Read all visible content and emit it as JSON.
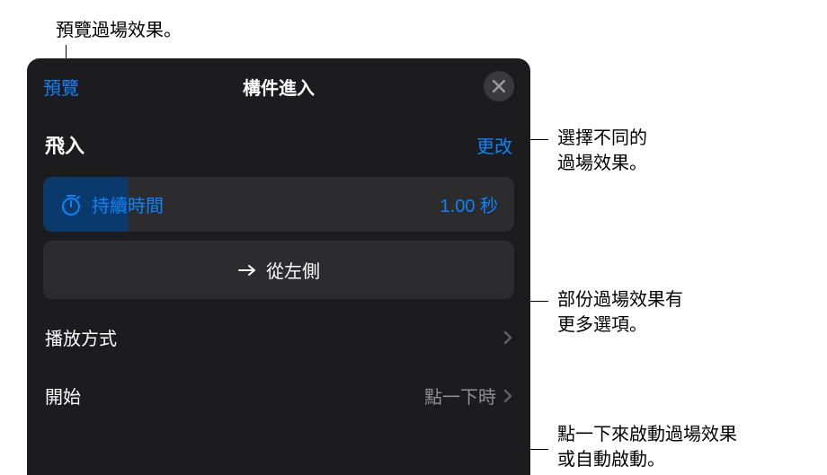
{
  "annotations": {
    "top": "預覽過場效果。",
    "right1_line1": "選擇不同的",
    "right1_line2": "過場效果。",
    "right2_line1": "部份過場效果有",
    "right2_line2": "更多選項。",
    "right3_line1": "點一下來啟動過場效果",
    "right3_line2": "或自動啟動。"
  },
  "panel": {
    "preview": "預覽",
    "title": "構件進入",
    "effect_name": "飛入",
    "change": "更改",
    "duration_label": "持續時間",
    "duration_value": "1.00 秒",
    "direction": "從左側",
    "delivery_label": "播放方式",
    "start_label": "開始",
    "start_value": "點一下時"
  }
}
